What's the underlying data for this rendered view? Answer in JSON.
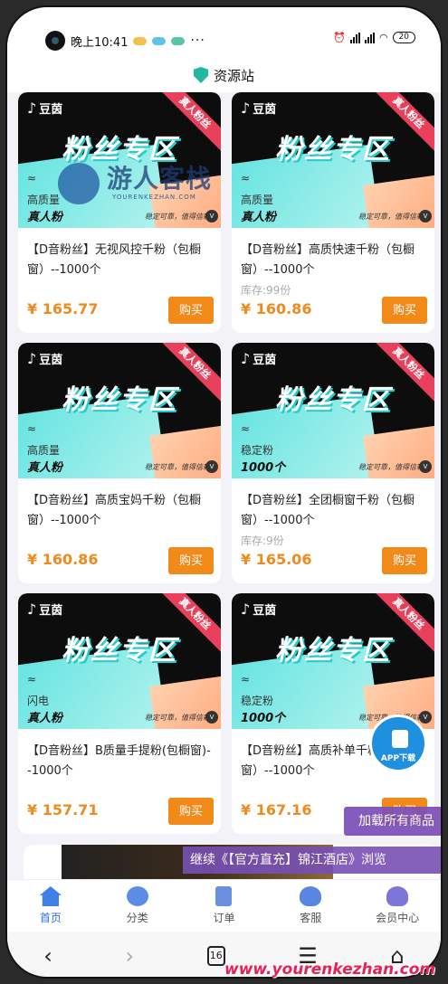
{
  "status": {
    "time": "晚上10:41",
    "dots": "···",
    "battery": "20"
  },
  "header": {
    "title": "资源站"
  },
  "products": [
    {
      "banner_title": "粉丝专区",
      "ribbon": "真人粉丝",
      "logo": "豆茵",
      "wave": "≈",
      "sub1": "高质量",
      "sub2": "真人粉",
      "tiny": "稳定可靠，值得信赖",
      "name": "【D音粉丝】无视风控千粉（包橱窗）--1000个",
      "stock": "",
      "price": "¥ 165.77",
      "buy": "购买"
    },
    {
      "banner_title": "粉丝专区",
      "ribbon": "真人粉丝",
      "logo": "豆茵",
      "wave": "≈",
      "sub1": "高质量",
      "sub2": "真人粉",
      "tiny": "稳定可靠，值得信赖",
      "name": "【D音粉丝】高质快速千粉（包橱窗）--1000个",
      "stock": "库存:99份",
      "price": "¥ 160.86",
      "buy": "购买"
    },
    {
      "banner_title": "粉丝专区",
      "ribbon": "真人粉丝",
      "logo": "豆茵",
      "wave": "≈",
      "sub1": "高质量",
      "sub2": "真人粉",
      "tiny": "稳定可靠，值得信赖",
      "name": "【D音粉丝】高质宝妈千粉（包橱窗）--1000个",
      "stock": "",
      "price": "¥ 160.86",
      "buy": "购买"
    },
    {
      "banner_title": "粉丝专区",
      "ribbon": "真人粉丝",
      "logo": "豆茵",
      "wave": "≈",
      "sub1": "稳定粉",
      "sub2": "1000个",
      "tiny": "稳定可靠，值得信赖",
      "name": "【D音粉丝】全团橱窗千粉（包橱窗）--1000个",
      "stock": "库存:9份",
      "price": "¥ 165.06",
      "buy": "购买"
    },
    {
      "banner_title": "粉丝专区",
      "ribbon": "真人粉丝",
      "logo": "豆茵",
      "wave": "≈",
      "sub1": "闪电",
      "sub2": "真人粉",
      "tiny": "稳定可靠，值得信赖",
      "name": "【D音粉丝】B质量手提粉(包橱窗)--1000个",
      "stock": "",
      "price": "¥ 157.71",
      "buy": "购买"
    },
    {
      "banner_title": "粉丝专区",
      "ribbon": "真人粉丝",
      "logo": "豆茵",
      "wave": "≈",
      "sub1": "稳定粉",
      "sub2": "1000个",
      "tiny": "稳定可靠，值得信赖",
      "name": "【D音粉丝】高质补单千粉（包橱窗）--1000个",
      "stock": "",
      "price": "¥ 167.16",
      "buy": "购买"
    }
  ],
  "floating": {
    "app_label": "APP下载",
    "load_more": "加载所有商品",
    "ticker": "继续《【官方直充】锦江酒店》浏览"
  },
  "tabbar": [
    {
      "label": "首页",
      "icon": "home-icon",
      "active": true
    },
    {
      "label": "分类",
      "icon": "category-icon",
      "active": false
    },
    {
      "label": "订单",
      "icon": "order-icon",
      "active": false
    },
    {
      "label": "客服",
      "icon": "service-icon",
      "active": false
    },
    {
      "label": "会员中心",
      "icon": "user-icon",
      "active": false
    }
  ],
  "navbar": {
    "back": "‹",
    "forward": "›",
    "tabs_count": "16",
    "menu": "☰",
    "home": "⌂"
  },
  "watermarks": {
    "overlay_text": "游人客栈",
    "overlay_sub": "YOURENKEZHAN.COM",
    "site_url": "www.yourenkezhan.com"
  },
  "colors": {
    "accent": "#f28a1a",
    "tab_active": "#2c6fe0",
    "ribbon": "#e8405a"
  }
}
